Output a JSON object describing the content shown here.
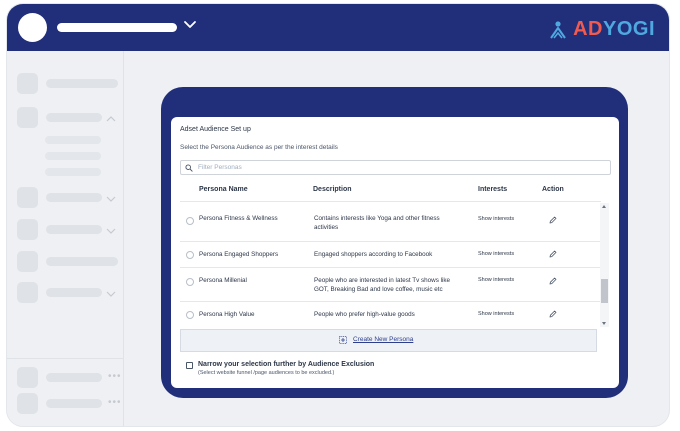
{
  "brand": {
    "name_part1": "AD",
    "name_part2": "YOGI",
    "primary_color": "#212f7b",
    "accent_blue": "#4fa8e0",
    "accent_red": "#f05a4f",
    "logo_icon": "adyogi-mark-icon"
  },
  "topbar": {
    "avatar_icon": "avatar",
    "dropdown_icon": "chevron-down-icon"
  },
  "panel": {
    "title": "Adset Audience Set up",
    "subtitle": "Select the Persona Audience as per the interest details",
    "search": {
      "placeholder": "Filter Personas",
      "value": "",
      "icon": "search-icon"
    },
    "columns": {
      "name": "Persona Name",
      "description": "Description",
      "interests": "Interests",
      "action": "Action"
    },
    "rows": [
      {
        "name": "Persona Fitness & Wellness",
        "description": "Contains interests like Yoga and other fitness activities",
        "interests_link": "Show interests",
        "action_icon": "pencil-icon"
      },
      {
        "name": "Persona Engaged Shoppers",
        "description": "Engaged shoppers according to Facebook",
        "interests_link": "Show interests",
        "action_icon": "pencil-icon"
      },
      {
        "name": "Persona Millenial",
        "description": "People who are interested in latest Tv shows like GOT, Breaking Bad and love coffee, music etc",
        "interests_link": "Show interests",
        "action_icon": "pencil-icon"
      },
      {
        "name": "Persona High Value",
        "description": "People who prefer high-value goods",
        "interests_link": "Show interests",
        "action_icon": "pencil-icon"
      }
    ],
    "create_button": "Create New Persona",
    "exclusion": {
      "title": "Narrow your selection further by Audience Exclusion",
      "note": "(Select website funnel /page audiences to be excluded.)",
      "checked": false
    }
  }
}
